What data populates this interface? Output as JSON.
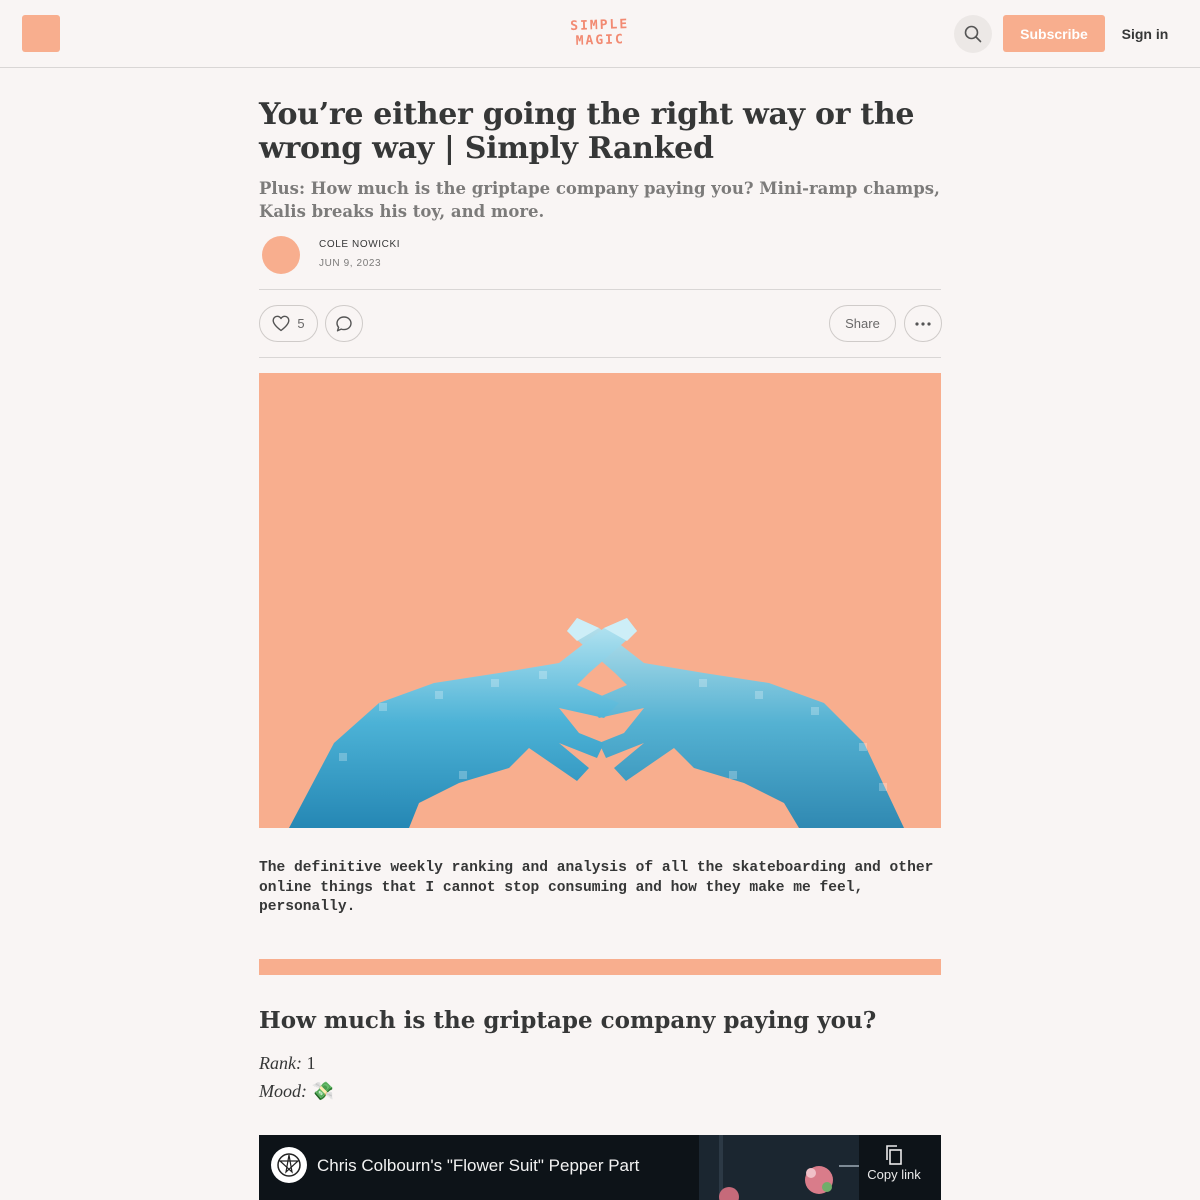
{
  "header": {
    "brand_line1": "SIMPLE",
    "brand_line2": "MAGIC",
    "search_icon": "search-icon",
    "subscribe_label": "Subscribe",
    "signin_label": "Sign in"
  },
  "post": {
    "title": "You’re either going the right way or the wrong way | Simply Ranked",
    "subtitle": "Plus: How much is the griptape company paying you? Mini-ramp champs, Kalis breaks his toy, and more.",
    "author": "COLE NOWICKI",
    "date": "JUN 9, 2023",
    "like_count": "5",
    "share_label": "Share",
    "intro": "The definitive weekly ranking and analysis of all the skateboarding and other online things that I cannot stop consuming and how they make me feel, personally."
  },
  "section1": {
    "heading": "How much is the griptape company paying you?",
    "rank_label": "Rank:",
    "rank_value": "1",
    "mood_label": "Mood:",
    "mood_value": "💸"
  },
  "video": {
    "title": "Chris Colbourn's \"Flower Suit\" Pepper Part",
    "copy_label": "Copy link"
  },
  "colors": {
    "accent": "#f8ae8e",
    "brand_text": "#f28a72",
    "text": "#363737",
    "muted": "#7c7b7a",
    "background": "#f9f5f4",
    "hands_blue": "#3aa6cf"
  }
}
